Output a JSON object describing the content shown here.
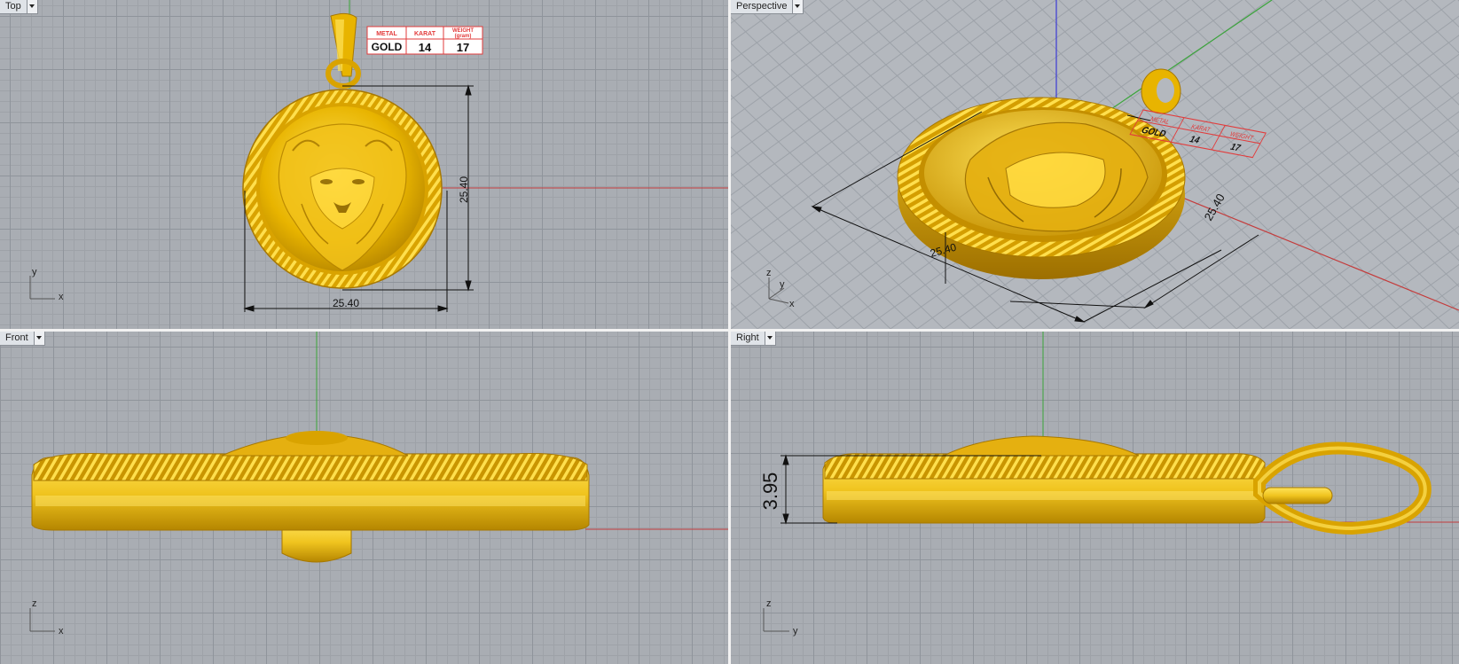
{
  "viewports": {
    "top": {
      "label": "Top"
    },
    "perspective": {
      "label": "Perspective"
    },
    "front": {
      "label": "Front"
    },
    "right": {
      "label": "Right"
    }
  },
  "spec_table": {
    "headers": [
      "METAL",
      "KARAT",
      "WEIGHT (gram)"
    ],
    "weight_header_line1": "WEIGHT",
    "weight_header_line2": "(gram)",
    "values": [
      "GOLD",
      "14",
      "17"
    ]
  },
  "dimensions": {
    "diameter_width": "25.40",
    "diameter_height": "25.40",
    "thickness": "3.95",
    "persp_overlap": "25.40"
  },
  "axes": {
    "top": [
      "y",
      "x"
    ],
    "perspective": [
      "z",
      "y",
      "x"
    ],
    "front": [
      "z",
      "x"
    ],
    "right": [
      "z",
      "y"
    ]
  },
  "colors": {
    "gold": "#e8b400",
    "gold_light": "#ffe35a",
    "gold_dark": "#a77800",
    "axis_red": "#c43c3c",
    "axis_green": "#3aa53a",
    "axis_blue": "#3b3bd6",
    "spec_red": "#e23b3b"
  }
}
